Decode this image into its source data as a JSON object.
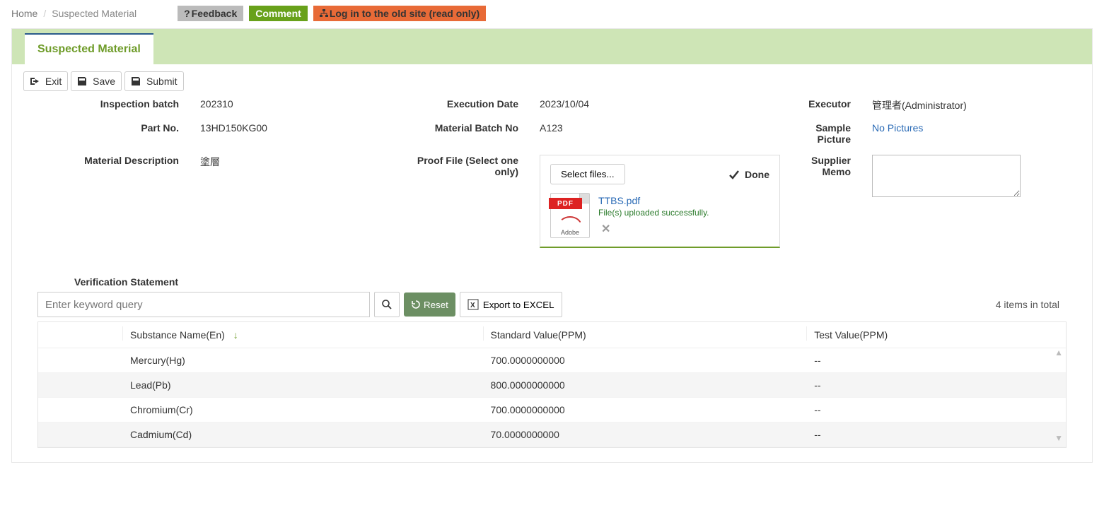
{
  "breadcrumb": {
    "home": "Home",
    "current": "Suspected Material"
  },
  "topbar": {
    "feedback": "Feedback",
    "comment": "Comment",
    "oldsite": "Log in to the old site (read only)"
  },
  "tab": {
    "title": "Suspected Material"
  },
  "toolbar": {
    "exit": "Exit",
    "save": "Save",
    "submit": "Submit"
  },
  "fields": {
    "inspection_batch_label": "Inspection batch",
    "inspection_batch": "202310",
    "execution_date_label": "Execution Date",
    "execution_date": "2023/10/04",
    "executor_label": "Executor",
    "executor": "管理者(Administrator)",
    "part_no_label": "Part No.",
    "part_no": "13HD150KG00",
    "material_batch_no_label": "Material Batch No",
    "material_batch_no": "A123",
    "sample_picture_label": "Sample Picture",
    "sample_picture": "No Pictures",
    "material_description_label": "Material Description",
    "material_description": "塗層",
    "proof_file_label": "Proof File (Select one only)",
    "supplier_memo_label": "Supplier Memo"
  },
  "upload": {
    "select_files": "Select files...",
    "done": "Done",
    "file_name": "TTBS.pdf",
    "status_msg": "File(s) uploaded successfully.",
    "pdf_badge": "PDF",
    "adobe": "Adobe"
  },
  "verification": {
    "section_label": "Verification Statement",
    "search_placeholder": "Enter keyword query",
    "reset": "Reset",
    "export": "Export to EXCEL",
    "total_text": "4 items in total",
    "columns": {
      "substance": "Substance Name(En)",
      "standard": "Standard Value(PPM)",
      "test": "Test Value(PPM)"
    },
    "rows": [
      {
        "substance": "Mercury(Hg)",
        "standard": "700.0000000000",
        "test": "--"
      },
      {
        "substance": "Lead(Pb)",
        "standard": "800.0000000000",
        "test": "--"
      },
      {
        "substance": "Chromium(Cr)",
        "standard": "700.0000000000",
        "test": "--"
      },
      {
        "substance": "Cadmium(Cd)",
        "standard": "70.0000000000",
        "test": "--"
      }
    ]
  }
}
